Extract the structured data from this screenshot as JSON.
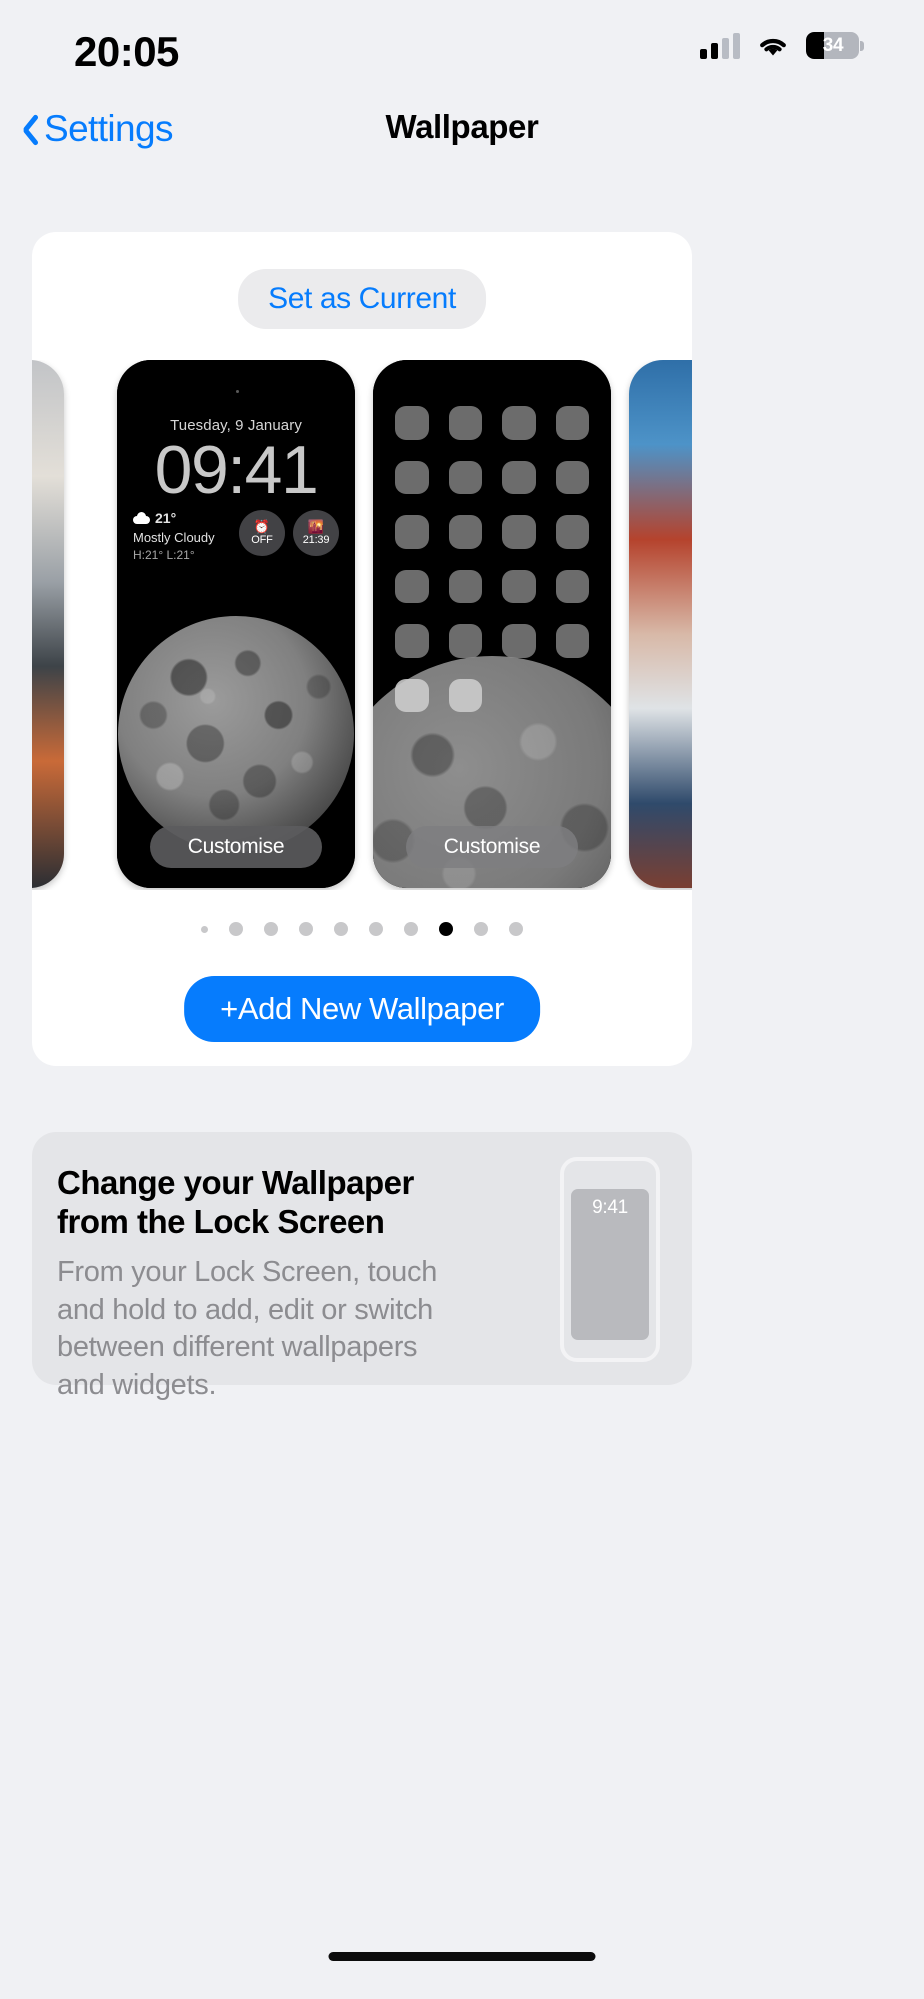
{
  "status_bar": {
    "time": "20:05",
    "battery_level": "34",
    "battery_percent": 34,
    "signal_icon": "cellular-signal-icon",
    "signal_bars_filled": 2,
    "signal_bars_total": 4,
    "wifi_icon": "wifi-icon",
    "battery_icon": "battery-icon"
  },
  "nav": {
    "back_label": "Settings",
    "back_icon": "chevron-left-icon",
    "title": "Wallpaper"
  },
  "wallpaper_card": {
    "set_as_current": "Set as Current",
    "lock_screen": {
      "date": "Tuesday, 9 January",
      "time": "09:41",
      "weather": {
        "icon": "cloud-icon",
        "temperature": "21°",
        "condition": "Mostly Cloudy",
        "high_low": "H:21° L:21°"
      },
      "alarm_widget": {
        "icon": "alarm-clock-icon",
        "value": "OFF"
      },
      "sunset_widget": {
        "icon": "sunset-icon",
        "value": "21:39"
      },
      "customise_label": "Customise"
    },
    "home_screen": {
      "customise_label": "Customise",
      "app_rows": 6,
      "app_columns": 4
    },
    "pagination": {
      "total": 10,
      "active_index": 7
    },
    "add_button": {
      "plus": "+",
      "label": "Add New Wallpaper"
    }
  },
  "info_card": {
    "title": "Change your Wallpaper from the Lock Screen",
    "body": "From your Lock Screen, touch and hold to add, edit or switch between different wallpapers and widgets.",
    "phone_illustration_time": "9:41"
  },
  "colors": {
    "accent_blue": "#067cfd",
    "page_background": "#f0f1f4",
    "card_background": "#ffffff",
    "info_card_background": "#e4e5e8",
    "secondary_text": "#8c8c90"
  }
}
